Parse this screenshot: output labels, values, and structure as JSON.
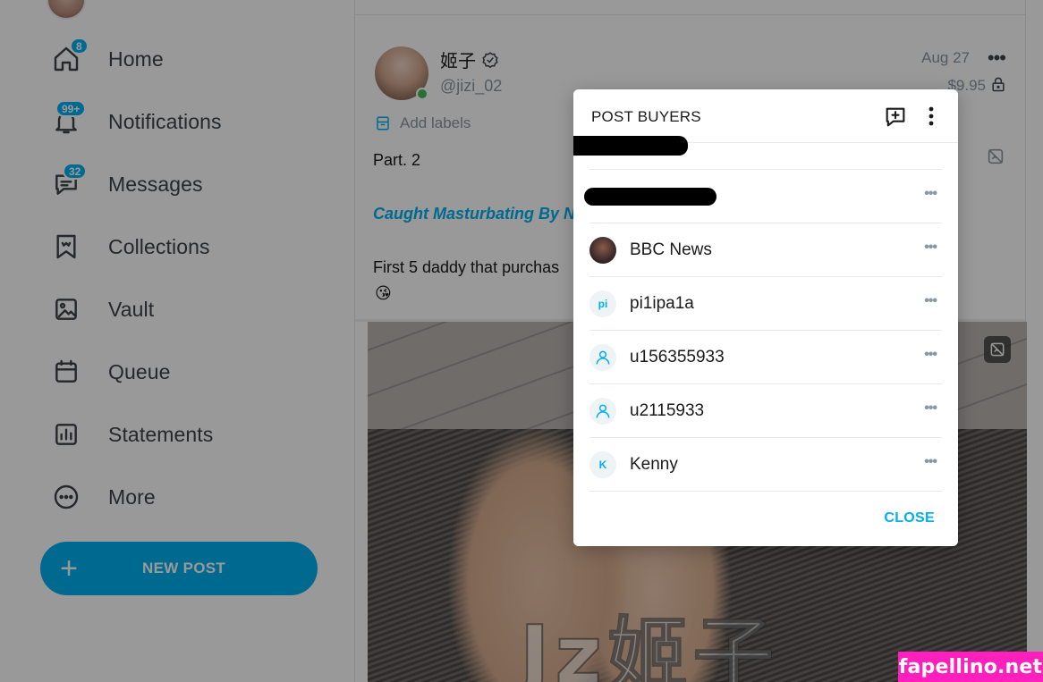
{
  "sidebar": {
    "items": [
      {
        "label": "Home",
        "icon": "home-icon",
        "badge": "8"
      },
      {
        "label": "Notifications",
        "icon": "bell-icon",
        "badge": "99+"
      },
      {
        "label": "Messages",
        "icon": "message-icon",
        "badge": "32"
      },
      {
        "label": "Collections",
        "icon": "collections-icon",
        "badge": ""
      },
      {
        "label": "Vault",
        "icon": "vault-icon",
        "badge": ""
      },
      {
        "label": "Queue",
        "icon": "calendar-icon",
        "badge": ""
      },
      {
        "label": "Statements",
        "icon": "statements-icon",
        "badge": ""
      },
      {
        "label": "More",
        "icon": "more-icon",
        "badge": ""
      }
    ],
    "new_post_label": "NEW POST"
  },
  "post": {
    "author_name": "姬子",
    "author_handle": "@jizi_02",
    "date": "Aug 27",
    "price": "$9.95",
    "add_labels": "Add labels",
    "line1": "Part. 2",
    "line2": "Caught Masturbating By N",
    "line3": "First 5 daddy that purchas",
    "emoji": "😘",
    "watermark": "Jz姬子"
  },
  "modal": {
    "title": "POST BUYERS",
    "buyers": [
      {
        "name": "",
        "avatar": "",
        "redacted": true
      },
      {
        "name": "",
        "avatar": "",
        "redacted": true
      },
      {
        "name": "BBC News",
        "avatar": "photo",
        "redacted": false
      },
      {
        "name": "pi1ipa1a",
        "avatar": "pi",
        "redacted": false
      },
      {
        "name": "u156355933",
        "avatar": "user-icon",
        "redacted": false
      },
      {
        "name": "u2115933",
        "avatar": "user-icon",
        "redacted": false
      },
      {
        "name": "Kenny",
        "avatar": "K",
        "redacted": false
      }
    ],
    "close_label": "CLOSE"
  },
  "site_badge": "fapellino.net",
  "colors": {
    "accent": "#00aff0",
    "text_muted": "#8a96a3",
    "online": "#3dbd5b",
    "site_badge": "#ff1fbd"
  }
}
